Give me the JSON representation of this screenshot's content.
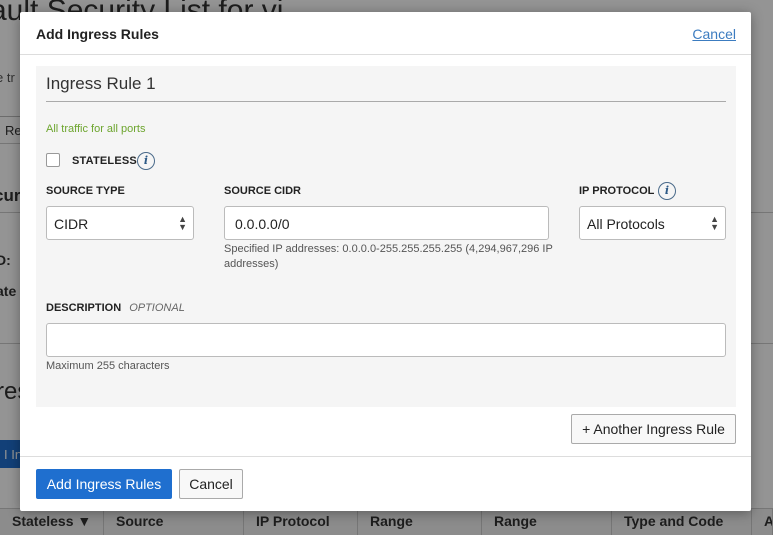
{
  "background": {
    "title_fragment": "ault Security List for vi",
    "subtitle_fragment": "e tr",
    "tab_fragment": "Re",
    "section_fragment": "curi",
    "ocid_fragment": "D:",
    "state_fragment": "ate",
    "ingress_fragment": "res",
    "add_button_fragment": "I Ing",
    "table_headers": [
      "Stateless ▼",
      "Source",
      "IP Protocol",
      "Range",
      "Range",
      "Type and Code",
      "A"
    ]
  },
  "modal": {
    "title": "Add Ingress Rules",
    "cancel_link": "Cancel",
    "rule": {
      "title": "Ingress Rule 1",
      "traffic_note": "All traffic for all ports",
      "stateless_label": "STATELESS",
      "stateless_checked": false,
      "source_type": {
        "label": "SOURCE TYPE",
        "value": "CIDR"
      },
      "source_cidr": {
        "label": "SOURCE CIDR",
        "value": "0.0.0.0/0",
        "hint": "Specified IP addresses: 0.0.0.0-255.255.255.255 (4,294,967,296 IP addresses)"
      },
      "ip_protocol": {
        "label": "IP PROTOCOL",
        "value": "All Protocols"
      },
      "description": {
        "label": "DESCRIPTION",
        "optional": "OPTIONAL",
        "value": "",
        "hint": "Maximum 255 characters"
      }
    },
    "another_rule_button": "+ Another Ingress Rule",
    "submit_button": "Add Ingress Rules",
    "cancel_button": "Cancel"
  },
  "colors": {
    "primary": "#1f6fcf",
    "link": "#3c7cc0",
    "note_green": "#6da52e",
    "panel_bg": "#f5f5f5"
  },
  "icons": [
    "info-icon",
    "chevron-updown-icon",
    "checkbox-icon"
  ]
}
